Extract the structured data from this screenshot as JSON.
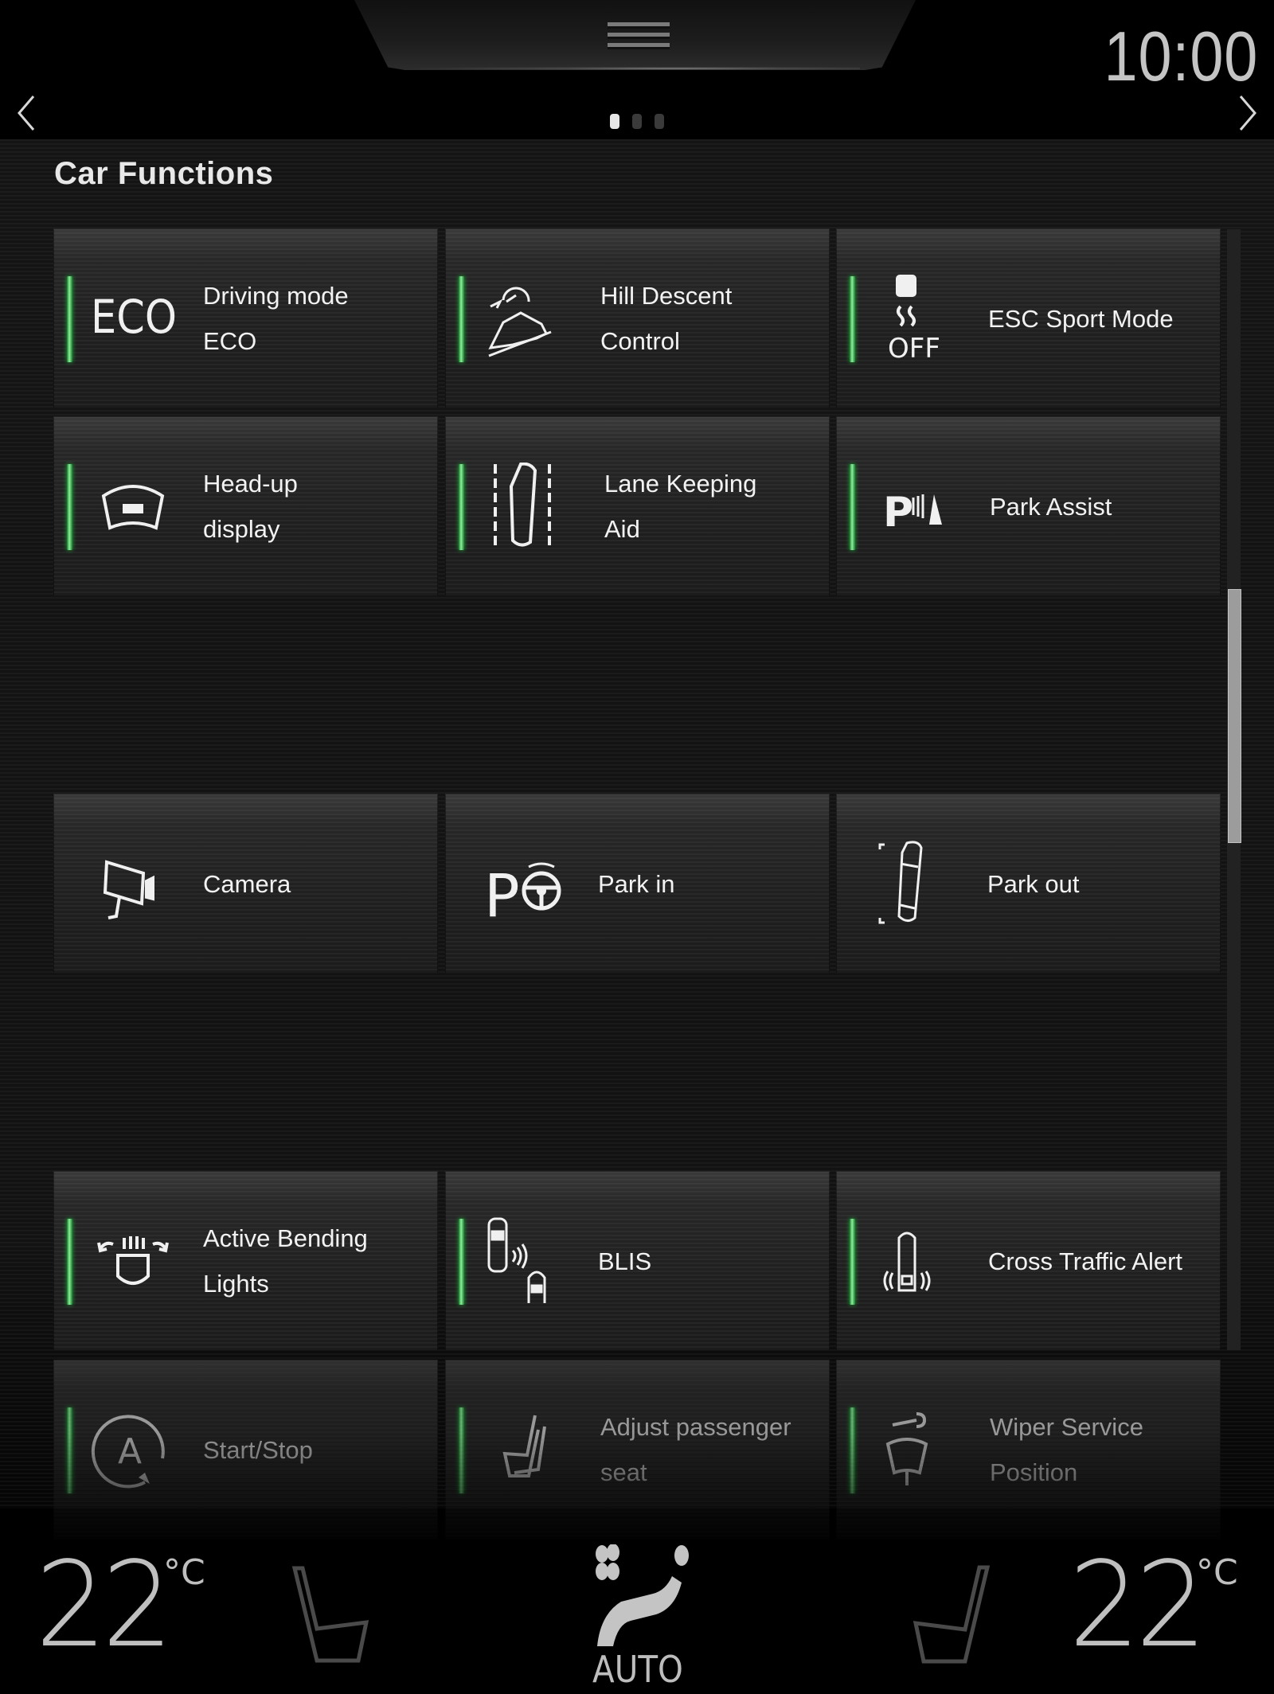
{
  "status_bar": {
    "clock": "10:00",
    "menu_handle_icon": "hamburger-icon",
    "prev_icon": "chevron-left-icon",
    "next_icon": "chevron-right-icon",
    "pages": {
      "count": 3,
      "active_index": 0
    }
  },
  "page": {
    "title": "Car Functions",
    "scroll_position_fraction": 0.32
  },
  "tiles": [
    {
      "id": "driving-mode-eco",
      "icon": "eco-icon",
      "label_line1": "Driving mode",
      "label_line2": "ECO",
      "active": true
    },
    {
      "id": "hill-descent-control",
      "icon": "hill-descent-icon",
      "label_line1": "Hill Descent",
      "label_line2": "Control",
      "active": true
    },
    {
      "id": "esc-sport-mode",
      "icon": "esc-off-icon",
      "label_line1": "ESC Sport Mode",
      "label_line2": "",
      "active": true
    },
    {
      "id": "head-up-display",
      "icon": "head-up-display-icon",
      "label_line1": "Head-up",
      "label_line2": "display",
      "active": true
    },
    {
      "id": "lane-keeping-aid",
      "icon": "lane-keeping-icon",
      "label_line1": "Lane Keeping",
      "label_line2": "Aid",
      "active": true
    },
    {
      "id": "park-assist",
      "icon": "park-assist-icon",
      "label_line1": "Park Assist",
      "label_line2": "",
      "active": true
    },
    {
      "id": "camera",
      "icon": "camera-icon",
      "label_line1": "Camera",
      "label_line2": "",
      "active": false
    },
    {
      "id": "park-in",
      "icon": "park-in-icon",
      "label_line1": "Park in",
      "label_line2": "",
      "active": false
    },
    {
      "id": "park-out",
      "icon": "park-out-icon",
      "label_line1": "Park out",
      "label_line2": "",
      "active": false
    },
    {
      "id": "active-bending-lights",
      "icon": "bending-lights-icon",
      "label_line1": "Active Bending",
      "label_line2": "Lights",
      "active": true
    },
    {
      "id": "blis",
      "icon": "blis-icon",
      "label_line1": "BLIS",
      "label_line2": "",
      "active": true
    },
    {
      "id": "cross-traffic-alert",
      "icon": "cross-traffic-icon",
      "label_line1": "Cross Traffic Alert",
      "label_line2": "",
      "active": true
    },
    {
      "id": "start-stop",
      "icon": "start-stop-icon",
      "label_line1": "Start/Stop",
      "label_line2": "",
      "active": true
    },
    {
      "id": "adjust-passenger-seat",
      "icon": "passenger-seat-icon",
      "label_line1": "Adjust passenger",
      "label_line2": "seat",
      "active": true
    },
    {
      "id": "wiper-service-position",
      "icon": "wiper-service-icon",
      "label_line1": "Wiper Service",
      "label_line2": "Position",
      "active": true
    }
  ],
  "climate": {
    "driver_temp": "22",
    "passenger_temp": "22",
    "unit": "°C",
    "fan_label": "AUTO",
    "driver_seat_icon": "driver-seat-heat-icon",
    "passenger_seat_icon": "passenger-seat-heat-icon",
    "fan_icon": "fan-auto-icon"
  },
  "colors": {
    "active_indicator": "#2ecc4a",
    "text": "#f0f0f0",
    "background": "#000000"
  }
}
